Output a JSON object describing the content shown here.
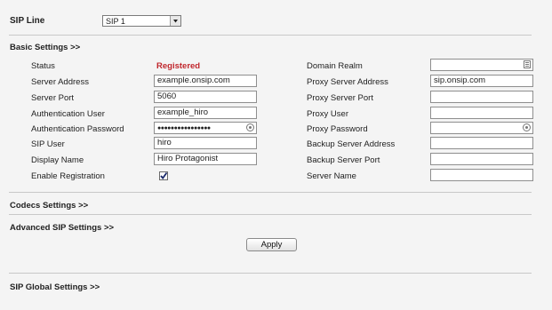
{
  "sip_line": {
    "label": "SIP Line",
    "selected": "SIP 1"
  },
  "sections": {
    "basic": "Basic Settings >>",
    "codecs": "Codecs Settings >>",
    "advanced": "Advanced SIP Settings >>",
    "global": "SIP Global Settings >>"
  },
  "left": {
    "status_label": "Status",
    "status_value": "Registered",
    "server_address_label": "Server Address",
    "server_address_value": "example.onsip.com",
    "server_port_label": "Server Port",
    "server_port_value": "5060",
    "auth_user_label": "Authentication User",
    "auth_user_value": "example_hiro",
    "auth_password_label": "Authentication Password",
    "auth_password_value": "●●●●●●●●●●●●●●●●",
    "sip_user_label": "SIP User",
    "sip_user_value": "hiro",
    "display_name_label": "Display Name",
    "display_name_value": "Hiro Protagonist",
    "enable_registration_label": "Enable Registration",
    "enable_registration_checked": true
  },
  "right": {
    "domain_realm_label": "Domain Realm",
    "domain_realm_value": "",
    "proxy_server_address_label": "Proxy Server Address",
    "proxy_server_address_value": "sip.onsip.com",
    "proxy_server_port_label": "Proxy Server Port",
    "proxy_server_port_value": "",
    "proxy_user_label": "Proxy User",
    "proxy_user_value": "",
    "proxy_password_label": "Proxy Password",
    "proxy_password_value": "",
    "backup_server_address_label": "Backup Server Address",
    "backup_server_address_value": "",
    "backup_server_port_label": "Backup Server Port",
    "backup_server_port_value": "",
    "server_name_label": "Server Name",
    "server_name_value": ""
  },
  "apply_label": "Apply",
  "colors": {
    "status": "#c0262c",
    "background": "#f4f4f4",
    "divider": "#c8c8c8"
  }
}
